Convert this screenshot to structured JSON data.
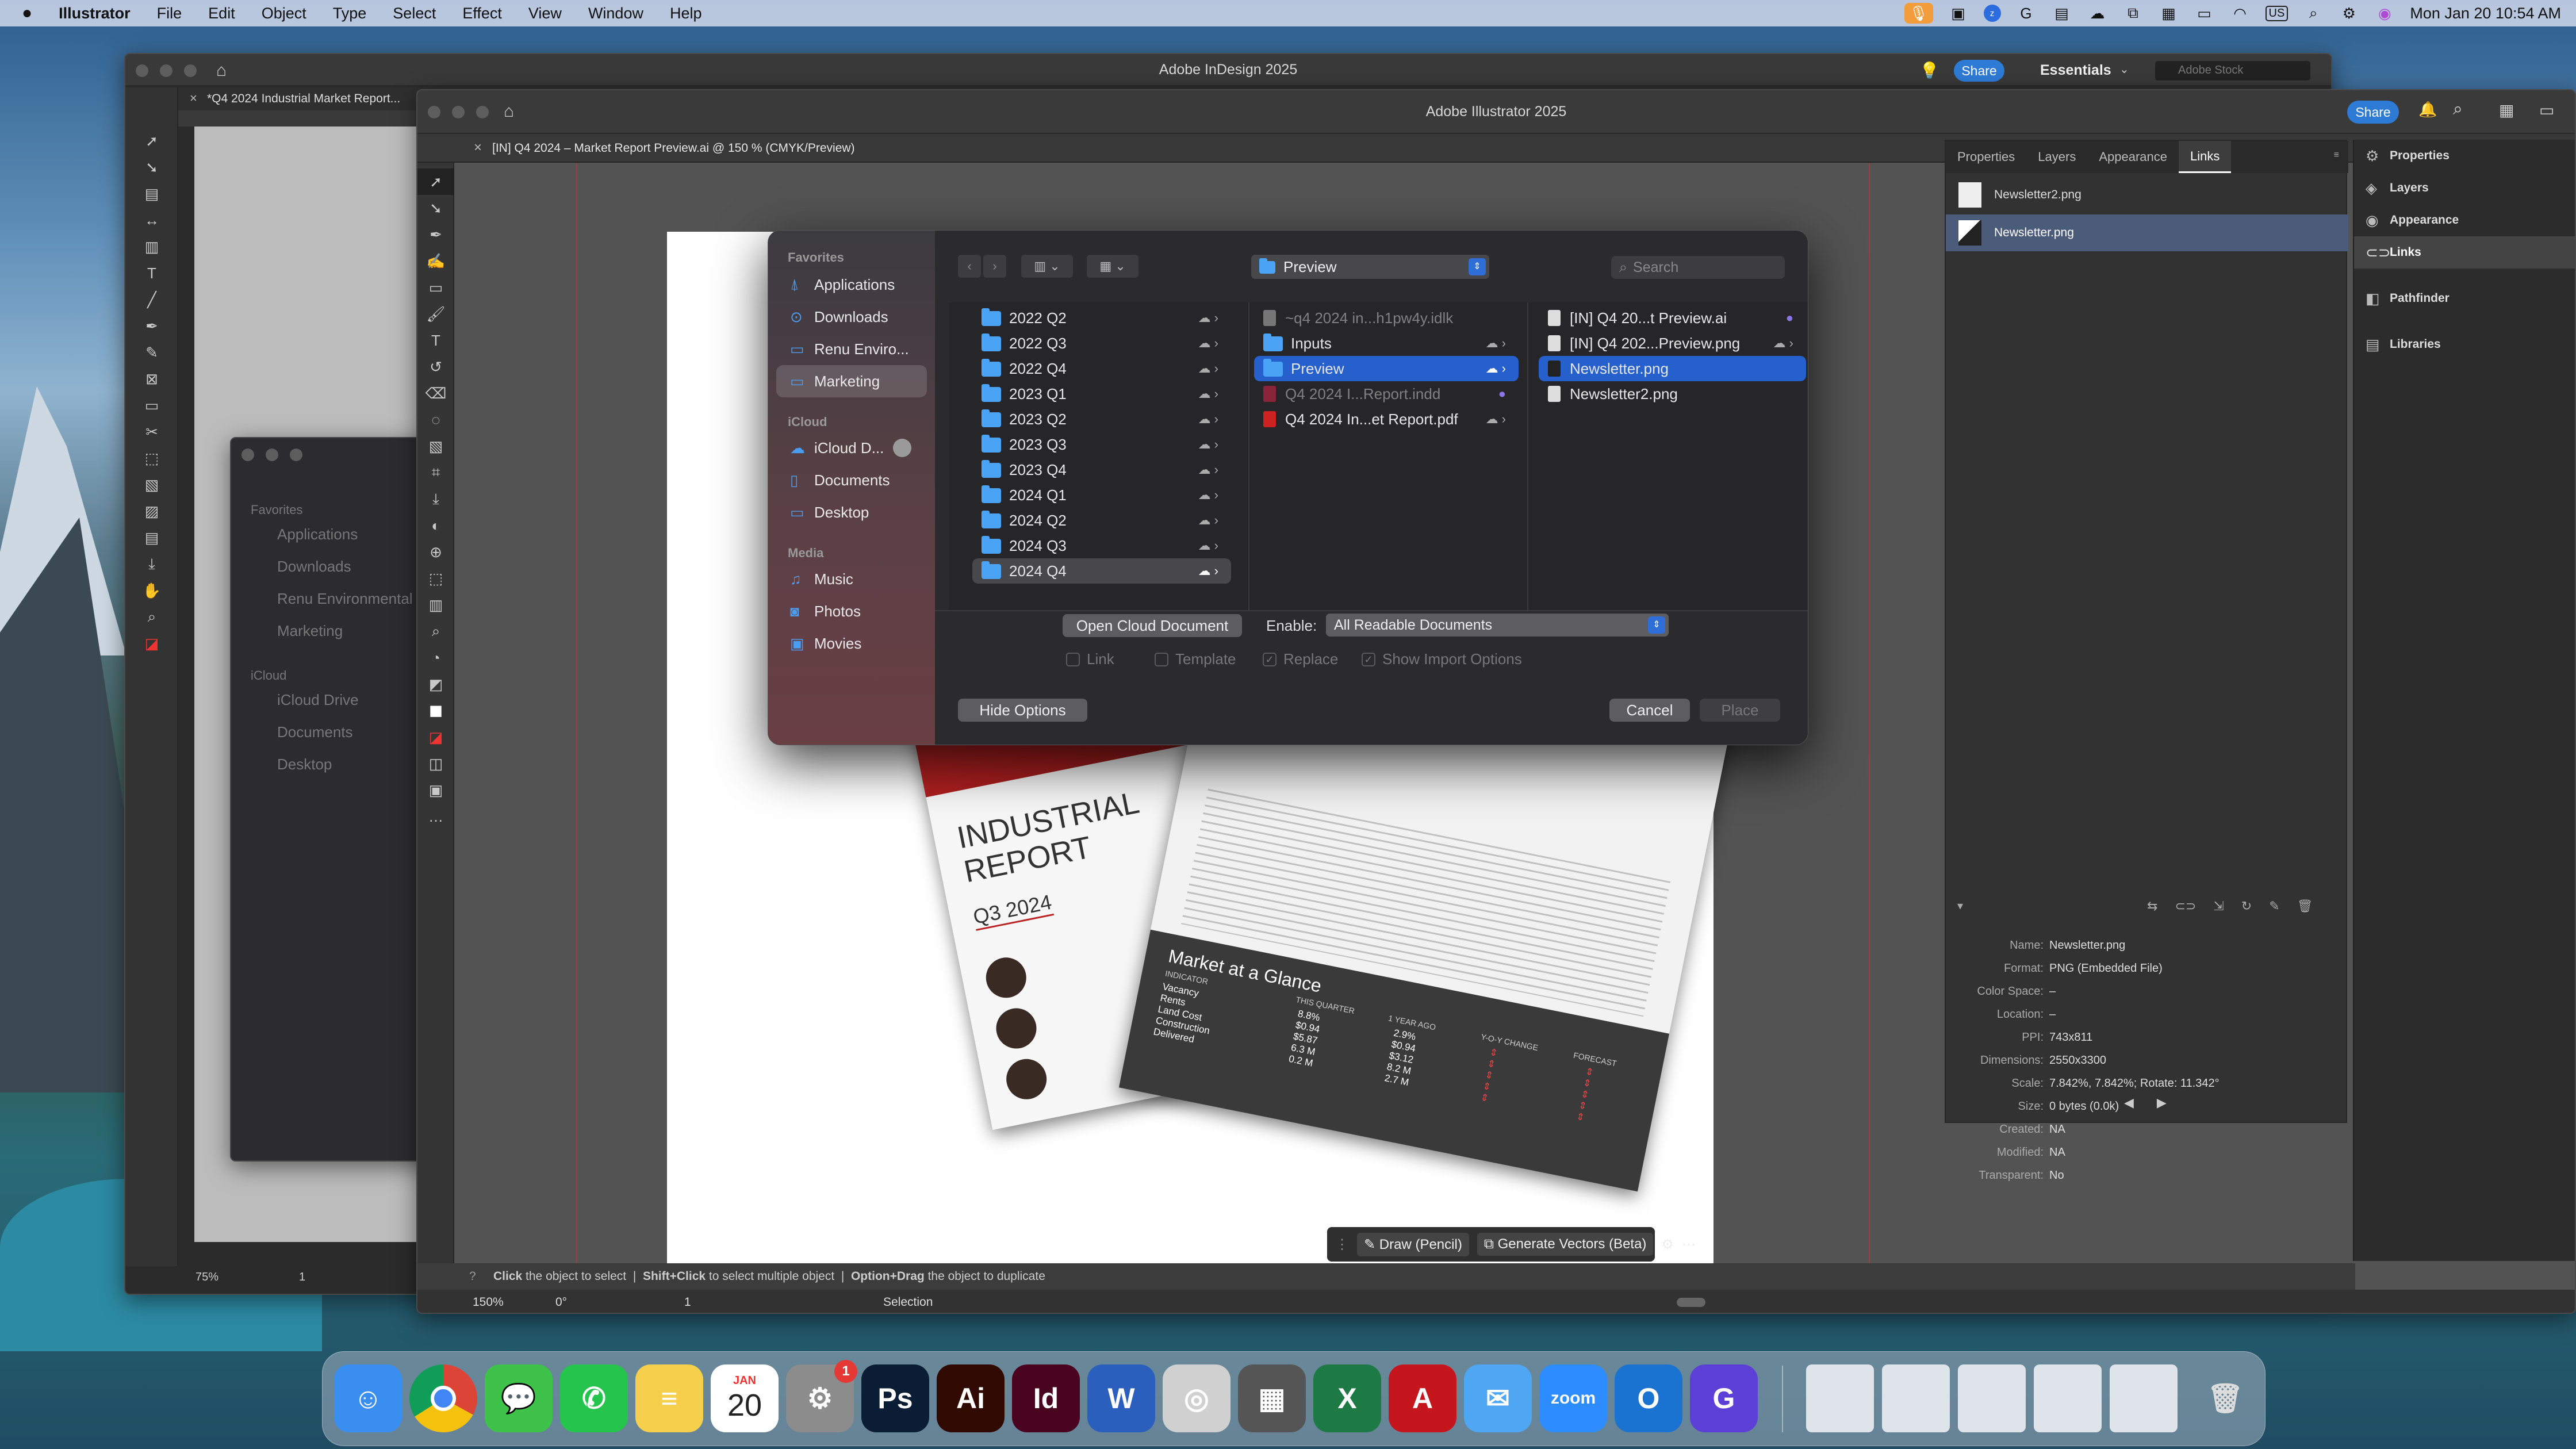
{
  "menubar": {
    "app": "Illustrator",
    "items": [
      "File",
      "Edit",
      "Object",
      "Type",
      "Select",
      "Effect",
      "View",
      "Window",
      "Help"
    ],
    "datetime": "Mon Jan 20  10:54 AM",
    "input_source": "US"
  },
  "indesign": {
    "title": "Adobe InDesign 2025",
    "doc_tab": "*Q4 2024 Industrial Market Report...",
    "share": "Share",
    "workspace": "Essentials",
    "stock_placeholder": "Adobe Stock",
    "zoom": "75%",
    "page": "1"
  },
  "illustrator": {
    "title": "Adobe Illustrator 2025",
    "doc_tab": "[IN] Q4 2024 – Market Report Preview.ai @ 150 % (CMYK/Preview)",
    "share": "Share",
    "zoom": "150%",
    "rotation": "0°",
    "artboard": "1",
    "status": "Selection",
    "hint_1": "Click",
    "hint_1b": " the object to select  |  ",
    "hint_2": "Shift+Click",
    "hint_2b": " to select multiple object  |  ",
    "hint_3": "Option+Drag",
    "hint_3b": " the object to duplicate",
    "draw_btn": "Draw (Pencil)",
    "gen_btn": "Generate Vectors (Beta)"
  },
  "bgfinder": {
    "favorites": "Favorites",
    "items": [
      "Applications",
      "Downloads",
      "Renu Environmental",
      "Marketing"
    ],
    "icloud": "iCloud",
    "icloud_items": [
      "iCloud Drive",
      "Documents",
      "Desktop"
    ]
  },
  "links_panel": {
    "tabs": [
      "Properties",
      "Layers",
      "Appearance",
      "Links"
    ],
    "files": [
      "Newsletter2.png",
      "Newsletter.png"
    ],
    "info": [
      [
        "Name:",
        "Newsletter.png"
      ],
      [
        "Format:",
        "PNG (Embedded File)"
      ],
      [
        "Color Space:",
        "–"
      ],
      [
        "Location:",
        "–"
      ],
      [
        "PPI:",
        "743x811"
      ],
      [
        "Dimensions:",
        "2550x3300"
      ],
      [
        "Scale:",
        "7.842%, 7.842%; Rotate: 11.342°"
      ],
      [
        "Size:",
        "0 bytes (0.0k)"
      ],
      [
        "Created:",
        "NA"
      ],
      [
        "Modified:",
        "NA"
      ],
      [
        "Transparent:",
        "No"
      ]
    ]
  },
  "right_dock": [
    "Properties",
    "Layers",
    "Appearance",
    "Links",
    "Pathfinder",
    "Libraries"
  ],
  "dialog": {
    "sidebar": {
      "favorites": "Favorites",
      "fav_items": [
        "Applications",
        "Downloads",
        "Renu Enviro...",
        "Marketing"
      ],
      "icloud": "iCloud",
      "icloud_items": [
        "iCloud D...",
        "Documents",
        "Desktop"
      ],
      "media": "Media",
      "media_items": [
        "Music",
        "Photos",
        "Movies"
      ]
    },
    "location": "Preview",
    "search_placeholder": "Search",
    "col1": [
      "2022 Q2",
      "2022 Q3",
      "2022 Q4",
      "2023 Q1",
      "2023 Q2",
      "2023 Q3",
      "2023 Q4",
      "2024 Q1",
      "2024 Q2",
      "2024 Q3",
      "2024 Q4"
    ],
    "col2": [
      "~q4 2024 in...h1pw4y.idlk",
      "Inputs",
      "Preview",
      "Q4 2024 I...Report.indd",
      "Q4 2024 In...et Report.pdf"
    ],
    "col3": [
      "[IN] Q4 20...t Preview.ai",
      "[IN] Q4 202...Preview.png",
      "Newsletter.png",
      "Newsletter2.png"
    ],
    "open_cloud": "Open Cloud Document",
    "enable_label": "Enable:",
    "enable_value": "All Readable Documents",
    "options": [
      "Link",
      "Template",
      "Replace",
      "Show Import Options"
    ],
    "hide_options": "Hide Options",
    "cancel": "Cancel",
    "place": "Place"
  },
  "artwork": {
    "title_1": "INDUSTRIAL",
    "title_2": "REPORT",
    "quarter": "Q3 2024",
    "glance": "Market at a Glance",
    "indicator": "INDICATOR",
    "cols": [
      "THIS QUARTER",
      "1 YEAR AGO",
      "Y-O-Y CHANGE",
      "FORECAST"
    ],
    "rows": [
      [
        "Vacancy",
        "8.8%",
        "2.9%"
      ],
      [
        "Rents",
        "$0.94",
        "$0.94"
      ],
      [
        "Land Cost",
        "$5.87",
        "$3.12"
      ],
      [
        "Construction",
        "6.3 M",
        "8.2 M"
      ],
      [
        "Delivered",
        "0.2 M",
        "2.7 M"
      ]
    ]
  },
  "dock": {
    "calendar_month": "JAN",
    "calendar_day": "20",
    "settings_badge": "1",
    "apps": [
      "Finder",
      "Chrome",
      "Messages",
      "WhatsApp",
      "Notes",
      "Calendar",
      "System Settings",
      "Photoshop",
      "Illustrator",
      "InDesign",
      "Word",
      "Screenshot",
      "Calculator",
      "Excel",
      "Acrobat",
      "Mail",
      "Zoom",
      "Outlook",
      "Grammarly"
    ]
  },
  "colors": {
    "accent": "#2560cc",
    "share": "#2e7bd6",
    "ps": "#0a1d35",
    "ai": "#300a00",
    "id": "#49021f"
  }
}
